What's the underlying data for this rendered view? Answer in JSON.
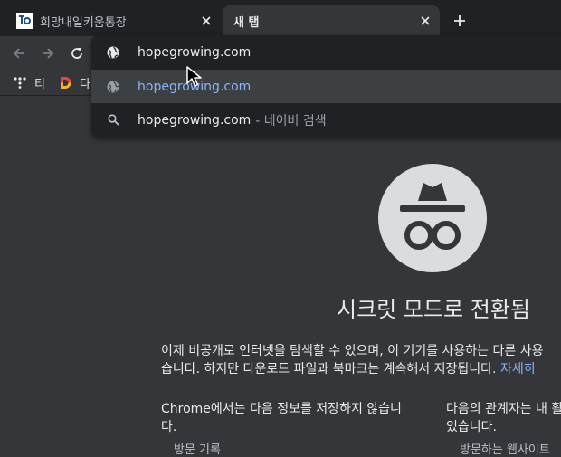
{
  "tabs": [
    {
      "title": "희망내일키움통장",
      "active": false
    },
    {
      "title": "새 탭",
      "active": true
    }
  ],
  "bookmarks": [
    {
      "label": "티",
      "icon": "tistory-icon"
    },
    {
      "label": "다",
      "icon": "daum-icon"
    }
  ],
  "omnibox": {
    "input": "hopegrowing.com",
    "suggestions": [
      {
        "text": "hopegrowing.com",
        "icon": "globe-icon",
        "selected": true
      },
      {
        "text": "hopegrowing.com",
        "suffix": "- 네이버 검색",
        "icon": "search-icon",
        "selected": false
      }
    ]
  },
  "incognito": {
    "title": "시크릿 모드로 전환됨",
    "description_line1": "이제 비공개로 인터넷을 탐색할 수 있으며, 이 기기를 사용하는 다른 사용",
    "description_line2": "습니다. 하지만 다운로드 파일과 북마크는 계속해서 저장됩니다.",
    "learn_more": "자세히",
    "left_heading_line1": "Chrome에서는 다음 정보를 저장하지 않습니",
    "left_heading_line2": "다.",
    "left_bullet_partial": "방문 기록",
    "right_heading_line1": "다음의 관계자는 내 활",
    "right_heading_line2": "있습니다.",
    "right_bullet_partial": "방문하는 웹사이트"
  },
  "colors": {
    "tabstrip": "#202124",
    "toolbar": "#35363a",
    "link": "#8ab4f8",
    "logo_circle": "#dadce0"
  }
}
